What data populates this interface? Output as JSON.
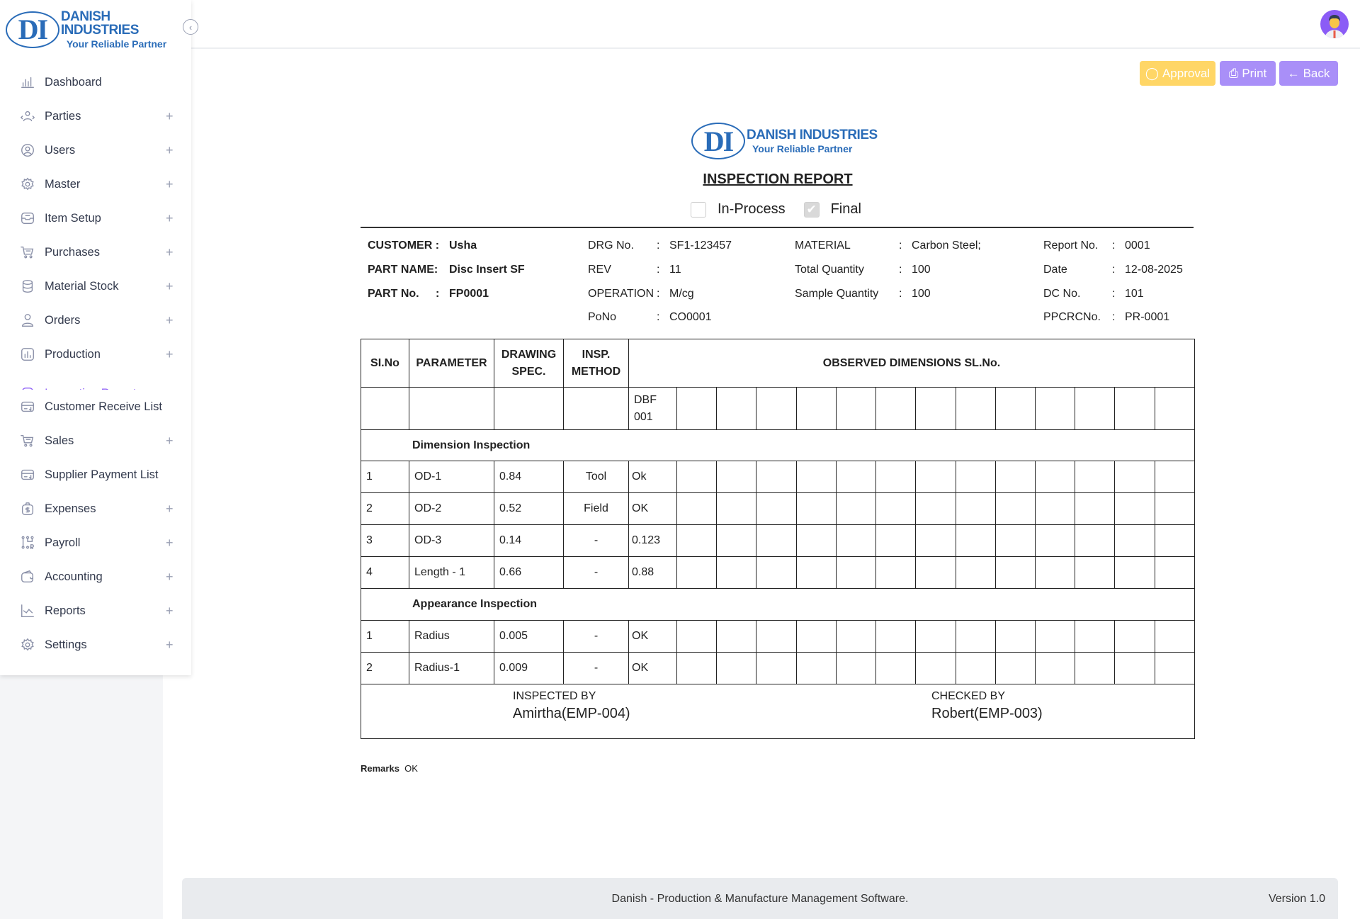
{
  "brand": {
    "mark": "DI",
    "name": "DANISH INDUSTRIES",
    "tagline": "Your Reliable Partner"
  },
  "sidebar": {
    "items": [
      {
        "label": "Dashboard",
        "icon": "bar-chart-icon",
        "expandable": false
      },
      {
        "label": "Parties",
        "icon": "people-icon",
        "expandable": true
      },
      {
        "label": "Users",
        "icon": "user-circle-icon",
        "expandable": true
      },
      {
        "label": "Master",
        "icon": "gear-icon",
        "expandable": true
      },
      {
        "label": "Item Setup",
        "icon": "inbox-icon",
        "expandable": true
      },
      {
        "label": "Purchases",
        "icon": "cart-icon",
        "expandable": true
      },
      {
        "label": "Material Stock",
        "icon": "database-icon",
        "expandable": true
      },
      {
        "label": "Orders",
        "icon": "user-icon",
        "expandable": true
      },
      {
        "label": "Production",
        "icon": "chart-box-icon",
        "expandable": true
      },
      {
        "label": "Inspection Report",
        "icon": "clipboard-icon",
        "expandable": false,
        "active": true
      },
      {
        "label": "Customer Receive List",
        "icon": "receive-card-icon",
        "expandable": false
      },
      {
        "label": "Sales",
        "icon": "cart-icon",
        "expandable": true
      },
      {
        "label": "Supplier Payment List",
        "icon": "receive-card-icon",
        "expandable": false
      },
      {
        "label": "Expenses",
        "icon": "money-bag-icon",
        "expandable": true
      },
      {
        "label": "Payroll",
        "icon": "payroll-icon",
        "expandable": true
      },
      {
        "label": "Accounting",
        "icon": "wallet-icon",
        "expandable": true
      },
      {
        "label": "Reports",
        "icon": "line-chart-icon",
        "expandable": true
      },
      {
        "label": "Settings",
        "icon": "gear-icon",
        "expandable": true
      }
    ]
  },
  "actions": {
    "approval": "Approval",
    "print": "Print",
    "back": "Back"
  },
  "colors": {
    "brand": "#2a6cb8",
    "approval": "#ffd666",
    "purple": "#a98ff8",
    "active": "#8b5cf6"
  },
  "report": {
    "title": "INSPECTION REPORT",
    "checks": [
      {
        "label": "In-Process",
        "checked": false
      },
      {
        "label": "Final",
        "checked": true
      }
    ],
    "customer": {
      "label": "CUSTOMER :",
      "value": "Usha"
    },
    "part_name": {
      "label": "PART NAME:",
      "value": "Disc Insert SF"
    },
    "part_no": {
      "label": "PART No.",
      "colon": ":",
      "value": "FP0001"
    },
    "col2": [
      {
        "label": "DRG No.",
        "value": "SF1-123457"
      },
      {
        "label": "REV",
        "value": "11"
      },
      {
        "label": "OPERATION",
        "value": "M/cg"
      },
      {
        "label": "PoNo",
        "value": "CO0001"
      }
    ],
    "col3": [
      {
        "label": "MATERIAL",
        "value": "Carbon Steel;"
      },
      {
        "label": "Total Quantity",
        "value": "100"
      },
      {
        "label": "Sample Quantity",
        "value": "100"
      }
    ],
    "col4": [
      {
        "label": "Report No.",
        "value": "0001"
      },
      {
        "label": "Date",
        "value": "12-08-2025"
      },
      {
        "label": "DC No.",
        "value": "101"
      },
      {
        "label": "PPCRCNo.",
        "value": "PR-0001"
      }
    ],
    "colon": ":",
    "headers": {
      "slno": "SI.No",
      "parameter": "PARAMETER",
      "drawing_1": "DRAWING",
      "drawing_2": "SPEC.",
      "insp_1": "INSP.",
      "insp_2": "METHOD",
      "observed": "OBSERVED DIMENSIONS SL.No."
    },
    "serial": {
      "line1": "DBF",
      "line2": "001"
    },
    "observed_columns": 14,
    "sections": [
      {
        "title": "Dimension Inspection",
        "rows": [
          {
            "slno": "1",
            "parameter": "OD-1",
            "spec": "0.84",
            "method": "Tool",
            "obs": "Ok"
          },
          {
            "slno": "2",
            "parameter": "OD-2",
            "spec": "0.52",
            "method": "Field",
            "obs": "OK"
          },
          {
            "slno": "3",
            "parameter": "OD-3",
            "spec": "0.14",
            "method": "-",
            "obs": "0.123"
          },
          {
            "slno": "4",
            "parameter": "Length - 1",
            "spec": "0.66",
            "method": "-",
            "obs": "0.88"
          }
        ]
      },
      {
        "title": "Appearance Inspection",
        "rows": [
          {
            "slno": "1",
            "parameter": "Radius",
            "spec": "0.005",
            "method": "-",
            "obs": "OK"
          },
          {
            "slno": "2",
            "parameter": "Radius-1",
            "spec": "0.009",
            "method": "-",
            "obs": "OK"
          }
        ]
      }
    ],
    "inspected_by": {
      "label": "INSPECTED BY",
      "name": "Amirtha(EMP-004)"
    },
    "checked_by": {
      "label": "CHECKED BY",
      "name": "Robert(EMP-003)"
    },
    "remarks": {
      "label": "Remarks",
      "value": "OK"
    }
  },
  "footer": {
    "text": "Danish - Production & Manufacture Management Software.",
    "version": "Version 1.0"
  }
}
